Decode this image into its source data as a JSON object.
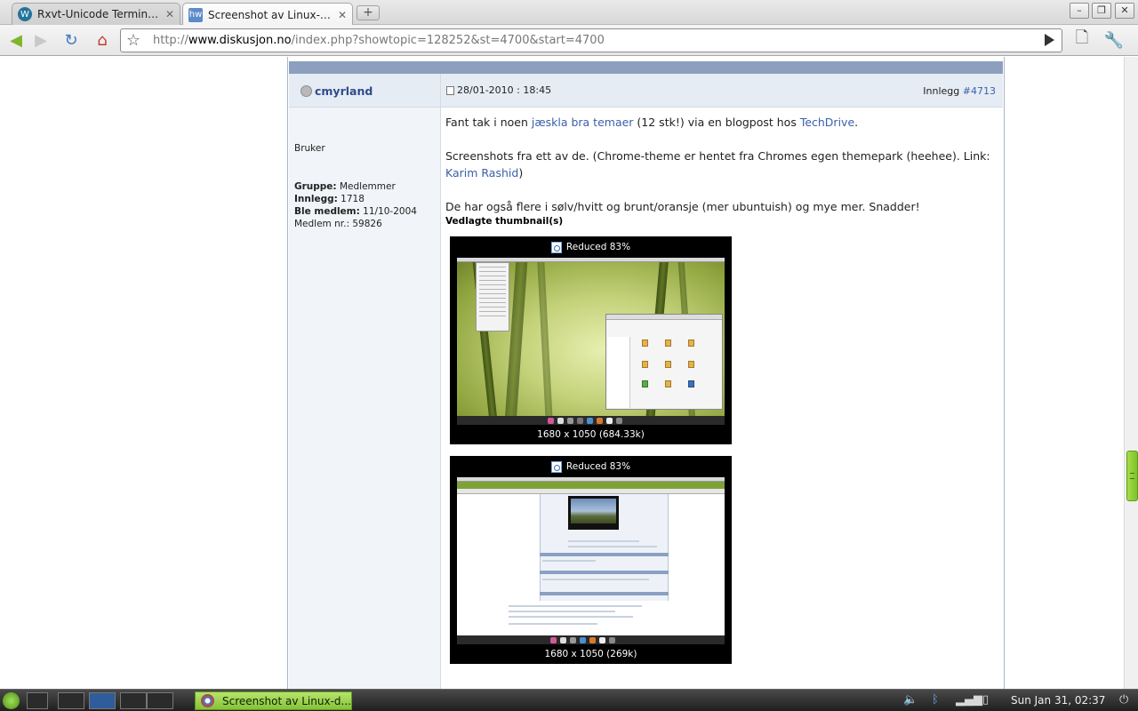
{
  "browser": {
    "tabs": [
      {
        "title": "Rxvt-Unicode Terminal ...",
        "favicon": "wordpress-icon",
        "active": false
      },
      {
        "title": "Screenshot av Linux-de...",
        "favicon": "hw-icon",
        "active": true
      }
    ],
    "url": {
      "scheme": "http://",
      "host": "www.diskusjon.no",
      "path": "/index.php?showtopic=128252&st=4700&start=4700"
    }
  },
  "post": {
    "username": "cmyrland",
    "date": "28/01-2010 : 18:45",
    "post_label": "Innlegg",
    "post_number": "#4713",
    "rank": "Bruker",
    "info": [
      {
        "label": "Gruppe:",
        "value": " Medlemmer"
      },
      {
        "label": "Innlegg:",
        "value": " 1718"
      },
      {
        "label": "Ble medlem:",
        "value": " 11/10-2004"
      },
      {
        "label": "",
        "value": "Medlem nr.: 59826"
      }
    ],
    "p1": {
      "a": "Fant tak i noen ",
      "link1": "jæskla bra temaer",
      "b": " (12 stk!) via en blogpost hos ",
      "link2": "TechDrive",
      "c": "."
    },
    "p2": {
      "a": "Screenshots fra ett av de. (Chrome-theme er hentet fra Chromes egen themepark (heehee). Link: ",
      "link": "Karim Rashid",
      "b": ")"
    },
    "p3": "De har også flere i sølv/hvitt og brunt/oransje (mer ubuntuish) og mye mer. Snadder!",
    "attach_label": "Vedlagte thumbnail(s)",
    "thumbs": [
      {
        "caption": "Reduced 83%",
        "size": "1680 x 1050 (684.33k)"
      },
      {
        "caption": "Reduced 83%",
        "size": "1680 x 1050 (269k)"
      }
    ]
  },
  "scrollbar": {
    "position": 0.68
  },
  "taskbar": {
    "task_title": "Screenshot av Linux-d...",
    "clock": "Sun Jan 31, 02:37"
  },
  "colors": {
    "accent_green": "#86c23a",
    "link_blue": "#3a5fa8",
    "forum_header": "#8d9fbe"
  }
}
